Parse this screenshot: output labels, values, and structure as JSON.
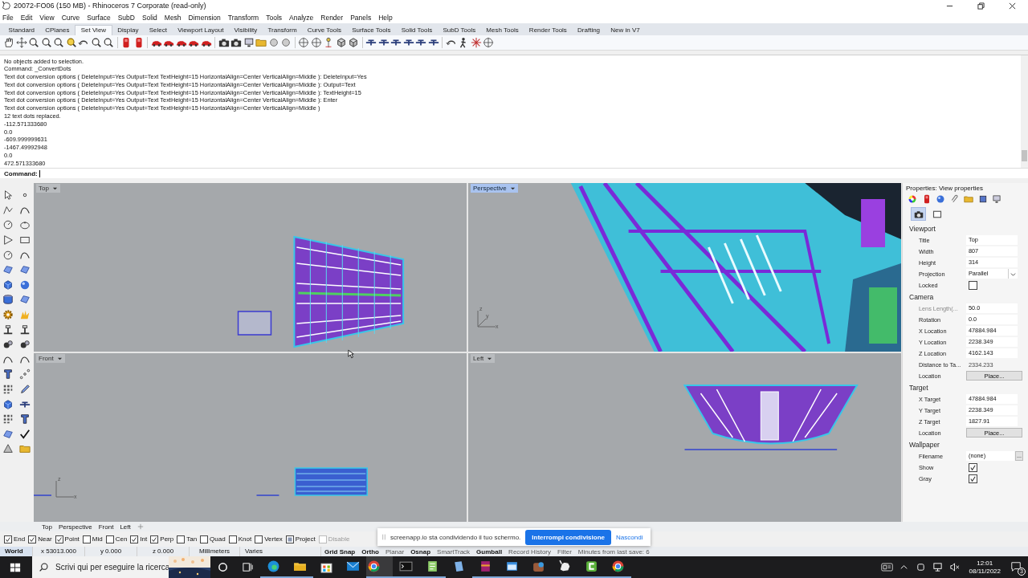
{
  "window": {
    "title": "20072-FO06 (150 MB) - Rhinoceros 7 Corporate (read-only)"
  },
  "menu": [
    "File",
    "Edit",
    "View",
    "Curve",
    "Surface",
    "SubD",
    "Solid",
    "Mesh",
    "Dimension",
    "Transform",
    "Tools",
    "Analyze",
    "Render",
    "Panels",
    "Help"
  ],
  "toolbar_tabs": [
    {
      "label": "Standard",
      "selected": false
    },
    {
      "label": "CPlanes",
      "selected": false
    },
    {
      "label": "Set View",
      "selected": true
    },
    {
      "label": "Display",
      "selected": false
    },
    {
      "label": "Select",
      "selected": false
    },
    {
      "label": "Viewport Layout",
      "selected": false
    },
    {
      "label": "Visibility",
      "selected": false
    },
    {
      "label": "Transform",
      "selected": false
    },
    {
      "label": "Curve Tools",
      "selected": false
    },
    {
      "label": "Surface Tools",
      "selected": false
    },
    {
      "label": "Solid Tools",
      "selected": false
    },
    {
      "label": "SubD Tools",
      "selected": false
    },
    {
      "label": "Mesh Tools",
      "selected": false
    },
    {
      "label": "Render Tools",
      "selected": false
    },
    {
      "label": "Drafting",
      "selected": false
    },
    {
      "label": "New in V7",
      "selected": false
    }
  ],
  "command_history": [
    "No objects added to selection.",
    "Command: _ConvertDots",
    "Text dot conversion options ( DeleteInput=Yes  Output=Text  TextHeight=15  HorizontalAlign=Center  VerticalAlign=Middle ): DeleteInput=Yes",
    "Text dot conversion options ( DeleteInput=Yes  Output=Text  TextHeight=15  HorizontalAlign=Center  VerticalAlign=Middle ): Output=Text",
    "Text dot conversion options ( DeleteInput=Yes  Output=Text  TextHeight=15  HorizontalAlign=Center  VerticalAlign=Middle ): TextHeight=15",
    "Text dot conversion options ( DeleteInput=Yes  Output=Text  TextHeight=15  HorizontalAlign=Center  VerticalAlign=Middle ): Enter",
    "Text dot conversion options ( DeleteInput=Yes  Output=Text  TextHeight=15  HorizontalAlign=Center  VerticalAlign=Middle )",
    "12 text dots replaced.",
    "-112.571333680",
    "0.0",
    "-609.999999631",
    "-1467.49992948",
    "0.0",
    "472.571333680"
  ],
  "command_prompt": {
    "label": "Command:"
  },
  "viewports": [
    {
      "title": "Top",
      "selected": false
    },
    {
      "title": "Perspective",
      "selected": true,
      "axes": [
        "z",
        "y",
        "x"
      ]
    },
    {
      "title": "Front",
      "selected": false,
      "axes": [
        "z",
        "x"
      ]
    },
    {
      "title": "Left",
      "selected": false
    }
  ],
  "viewport_tabs": [
    "Top",
    "Perspective",
    "Front",
    "Left"
  ],
  "osnaps": [
    {
      "label": "End",
      "kind": "snap",
      "checked": true,
      "disabled": false
    },
    {
      "label": "Near",
      "kind": "snap",
      "checked": true,
      "disabled": false
    },
    {
      "label": "Point",
      "kind": "snap",
      "checked": true,
      "disabled": false
    },
    {
      "label": "Mid",
      "kind": "snap",
      "checked": false,
      "disabled": false
    },
    {
      "label": "Cen",
      "kind": "snap",
      "checked": false,
      "disabled": false
    },
    {
      "label": "Int",
      "kind": "snap",
      "checked": true,
      "disabled": false
    },
    {
      "label": "Perp",
      "kind": "snap",
      "checked": true,
      "disabled": false
    },
    {
      "label": "Tan",
      "kind": "snap",
      "checked": false,
      "disabled": false
    },
    {
      "label": "Quad",
      "kind": "snap",
      "checked": false,
      "disabled": false
    },
    {
      "label": "Knot",
      "kind": "snap",
      "checked": false,
      "disabled": false
    },
    {
      "label": "Vertex",
      "kind": "snap",
      "checked": false,
      "disabled": false
    },
    {
      "label": "Project",
      "kind": "mode",
      "checked": true,
      "disabled": false
    },
    {
      "label": "Disable",
      "kind": "mode",
      "checked": false,
      "disabled": true
    }
  ],
  "status_bar": {
    "cplane": "World",
    "x": "x 53013.000",
    "y": "y 0.000",
    "z": "z 0.000",
    "units": "Millimeters",
    "layer": "Varies",
    "toggles": [
      {
        "label": "Grid Snap",
        "on": true
      },
      {
        "label": "Ortho",
        "on": true
      },
      {
        "label": "Planar",
        "on": false
      },
      {
        "label": "Osnap",
        "on": true
      },
      {
        "label": "SmartTrack",
        "on": false
      },
      {
        "label": "Gumball",
        "on": true
      },
      {
        "label": "Record History",
        "on": false
      },
      {
        "label": "Filter",
        "on": false
      }
    ],
    "message": "Minutes from last save: 6"
  },
  "properties": {
    "title": "Properties: View properties",
    "sections": [
      {
        "heading": "Viewport",
        "rows": [
          {
            "label": "Title",
            "kind": "text",
            "value": "Top",
            "disabled": false
          },
          {
            "label": "Width",
            "kind": "text",
            "value": "807",
            "disabled": false
          },
          {
            "label": "Height",
            "kind": "text",
            "value": "314",
            "disabled": false
          },
          {
            "label": "Projection",
            "kind": "select",
            "value": "Parallel",
            "disabled": false
          },
          {
            "label": "Locked",
            "kind": "check",
            "checked": false,
            "disabled": false
          }
        ]
      },
      {
        "heading": "Camera",
        "rows": [
          {
            "label": "Lens Length(...",
            "kind": "text",
            "value": "50.0",
            "disabled": true
          },
          {
            "label": "Rotation",
            "kind": "text",
            "value": "0.0",
            "disabled": false
          },
          {
            "label": "X Location",
            "kind": "text",
            "value": "47884.984",
            "disabled": false
          },
          {
            "label": "Y Location",
            "kind": "text",
            "value": "2238.349",
            "disabled": false
          },
          {
            "label": "Z Location",
            "kind": "text",
            "value": "4162.143",
            "disabled": false
          },
          {
            "label": "Distance to Ta...",
            "kind": "readonly",
            "value": "2334.233",
            "disabled": false
          },
          {
            "label": "Location",
            "kind": "button",
            "value": "Place...",
            "disabled": false
          }
        ]
      },
      {
        "heading": "Target",
        "rows": [
          {
            "label": "X Target",
            "kind": "text",
            "value": "47884.984",
            "disabled": false
          },
          {
            "label": "Y Target",
            "kind": "text",
            "value": "2238.349",
            "disabled": false
          },
          {
            "label": "Z Target",
            "kind": "text",
            "value": "1827.91",
            "disabled": false
          },
          {
            "label": "Location",
            "kind": "button",
            "value": "Place...",
            "disabled": false
          }
        ]
      },
      {
        "heading": "Wallpaper",
        "rows": [
          {
            "label": "Filename",
            "kind": "browse",
            "value": "(none)",
            "button": "...",
            "disabled": false
          },
          {
            "label": "Show",
            "kind": "check",
            "checked": true,
            "disabled": false
          },
          {
            "label": "Gray",
            "kind": "check",
            "checked": true,
            "disabled": false
          }
        ]
      }
    ]
  },
  "notification": {
    "message": "screenapp.io sta condividendo il tuo schermo.",
    "stop_button": "Interrompi condivisione",
    "hide_link": "Nascondi"
  },
  "taskbar": {
    "search_placeholder": "Scrivi qui per eseguire la ricerca",
    "apps": [
      {
        "running": true,
        "selected": false
      },
      {
        "running": true,
        "selected": false
      },
      {
        "running": false,
        "selected": false
      },
      {
        "running": false,
        "selected": false
      },
      {
        "running": true,
        "selected": true
      },
      {
        "running": true,
        "selected": false
      },
      {
        "running": true,
        "selected": false
      },
      {
        "running": false,
        "selected": false
      },
      {
        "running": true,
        "selected": false
      },
      {
        "running": true,
        "selected": false
      },
      {
        "running": true,
        "selected": false
      },
      {
        "running": true,
        "selected": false
      },
      {
        "running": true,
        "selected": false
      },
      {
        "running": true,
        "selected": false
      }
    ],
    "time": "12:01",
    "date": "08/11/2022",
    "notification_count": "3"
  }
}
